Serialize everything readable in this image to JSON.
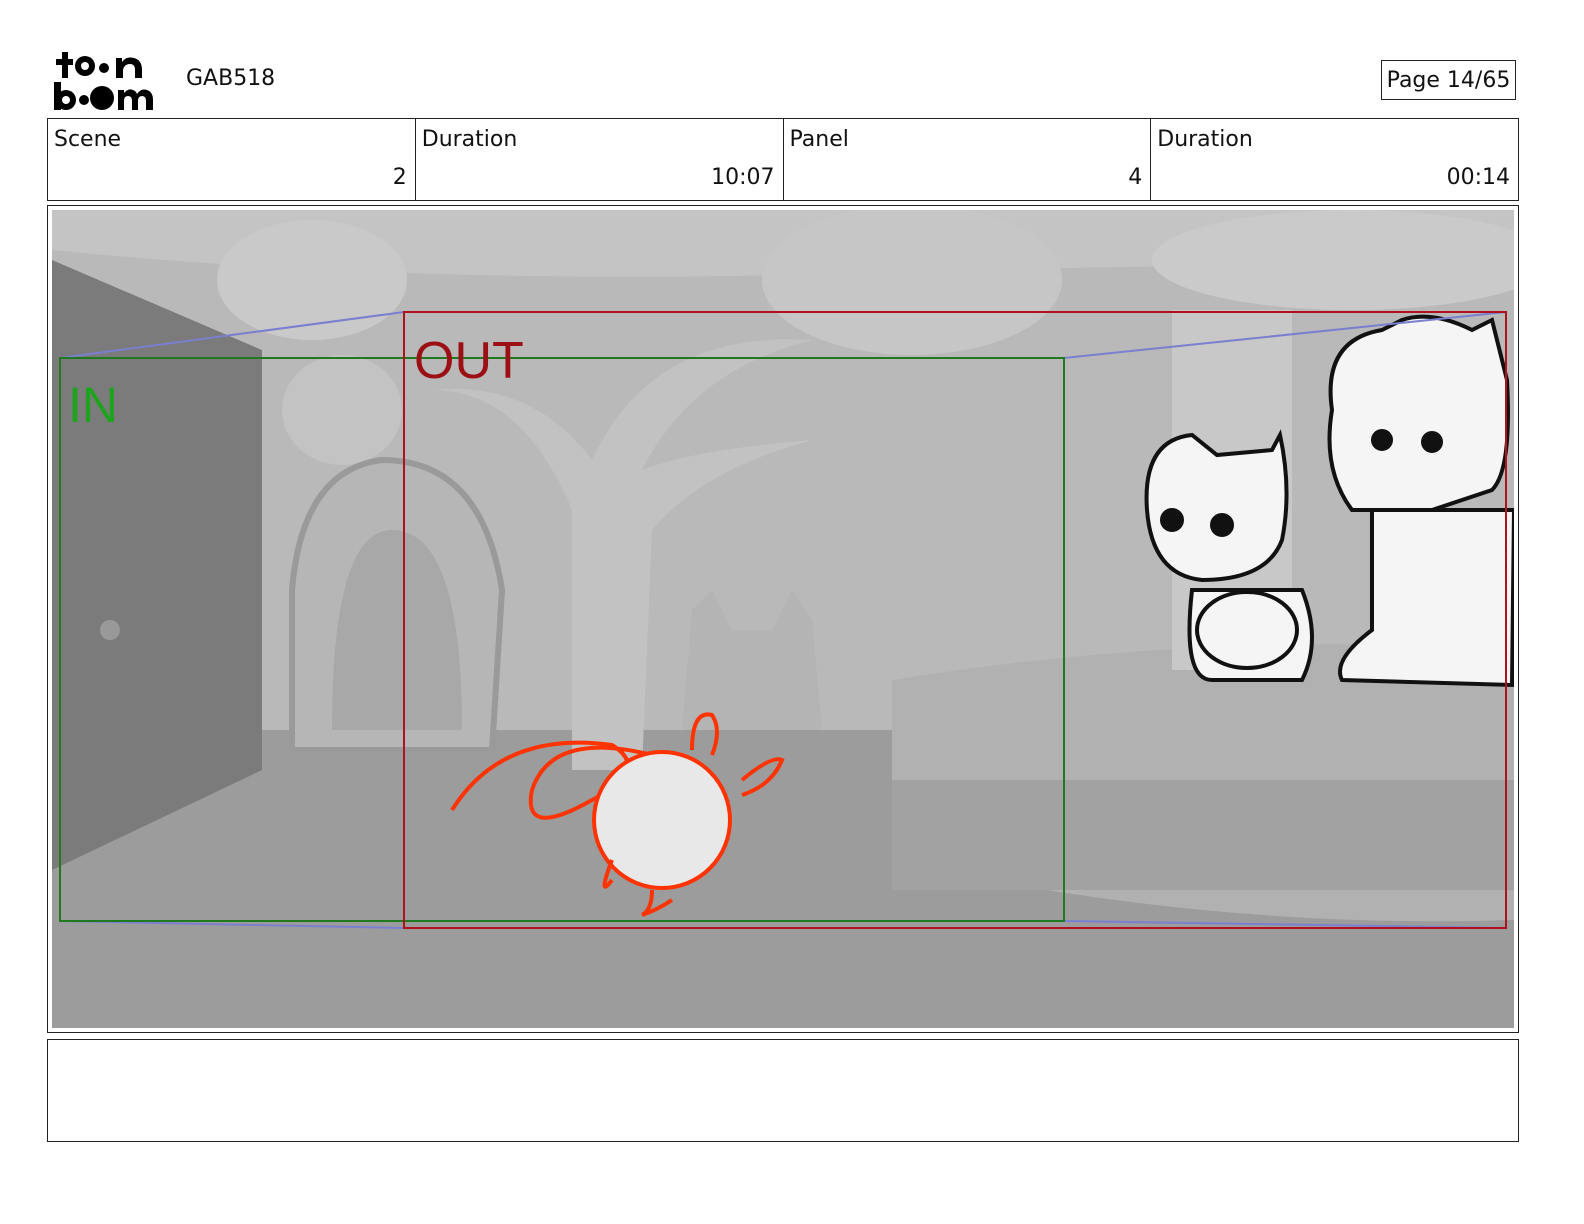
{
  "header": {
    "logo_text_top": "toon",
    "logo_text_bottom": "boom",
    "project_code": "GAB518",
    "page_label": "Page 14/65"
  },
  "info_table": {
    "scene_label": "Scene",
    "scene_value": "2",
    "scene_duration_label": "Duration",
    "scene_duration_value": "10:07",
    "panel_label": "Panel",
    "panel_value": "4",
    "panel_duration_label": "Duration",
    "panel_duration_value": "00:14"
  },
  "panel": {
    "in_label": "IN",
    "out_label": "OUT",
    "in_color": "#1f7a1f",
    "out_color": "#b0121b"
  },
  "notes": {
    "text": ""
  }
}
